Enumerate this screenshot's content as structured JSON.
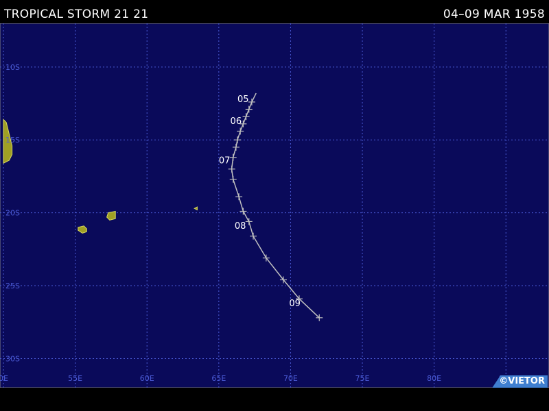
{
  "header": {
    "storm_name": "TROPICAL STORM 21 21",
    "date_range": "04–09 MAR 1958"
  },
  "map": {
    "projection": "lat-lon",
    "lon_range": [
      50,
      88
    ],
    "lat_range": [
      -7,
      -32
    ],
    "grid": true,
    "colors": {
      "ocean": "#0a0a5a",
      "grid": "#4b5bd6",
      "land": "#a0a024",
      "track": "#c0c0c0",
      "label": "#ffffff"
    },
    "lat_labels": [
      {
        "lat": -10,
        "text": "10S"
      },
      {
        "lat": -15,
        "text": "15S"
      },
      {
        "lat": -20,
        "text": "20S"
      },
      {
        "lat": -25,
        "text": "25S"
      },
      {
        "lat": -30,
        "text": "30S"
      }
    ],
    "lon_labels": [
      {
        "lon": 50,
        "text": "0E"
      },
      {
        "lon": 55,
        "text": "55E"
      },
      {
        "lon": 60,
        "text": "60E"
      },
      {
        "lon": 65,
        "text": "65E"
      },
      {
        "lon": 70,
        "text": "70E"
      },
      {
        "lon": 75,
        "text": "75E"
      },
      {
        "lon": 80,
        "text": "80E"
      },
      {
        "lon": 85,
        "text": "85E"
      }
    ],
    "track": [
      {
        "lon": 67.6,
        "lat": -11.8,
        "tick": false
      },
      {
        "lon": 67.3,
        "lat": -12.4,
        "tick": true
      },
      {
        "lon": 67.1,
        "lat": -12.9,
        "tick": true
      },
      {
        "lon": 66.9,
        "lat": -13.4,
        "tick": true
      },
      {
        "lon": 66.7,
        "lat": -13.9,
        "tick": true
      },
      {
        "lon": 66.5,
        "lat": -14.4,
        "tick": true
      },
      {
        "lon": 66.3,
        "lat": -15.0,
        "tick": true
      },
      {
        "lon": 66.2,
        "lat": -15.5,
        "tick": true
      },
      {
        "lon": 66.0,
        "lat": -16.2,
        "tick": true
      },
      {
        "lon": 65.9,
        "lat": -17.0,
        "tick": true
      },
      {
        "lon": 66.0,
        "lat": -17.7,
        "tick": true
      },
      {
        "lon": 66.4,
        "lat": -18.9,
        "tick": true
      },
      {
        "lon": 66.7,
        "lat": -19.9,
        "tick": true
      },
      {
        "lon": 67.1,
        "lat": -20.6,
        "tick": true
      },
      {
        "lon": 67.4,
        "lat": -21.6,
        "tick": true
      },
      {
        "lon": 68.3,
        "lat": -23.1,
        "tick": true
      },
      {
        "lon": 69.5,
        "lat": -24.6,
        "tick": true
      },
      {
        "lon": 70.6,
        "lat": -25.9,
        "tick": true
      },
      {
        "lon": 72.0,
        "lat": -27.2,
        "tick": true
      }
    ],
    "day_labels": [
      {
        "text": "05",
        "lon": 66.3,
        "lat": -12.4
      },
      {
        "text": "06",
        "lon": 65.8,
        "lat": -13.9
      },
      {
        "text": "07",
        "lon": 65.0,
        "lat": -16.6
      },
      {
        "text": "08",
        "lon": 66.1,
        "lat": -21.1
      },
      {
        "text": "09",
        "lon": 69.9,
        "lat": -26.4
      }
    ],
    "islands": [
      {
        "name": "madagascar-edge",
        "points": [
          [
            50.0,
            -13.6
          ],
          [
            50.2,
            -13.8
          ],
          [
            50.4,
            -14.6
          ],
          [
            50.6,
            -15.4
          ],
          [
            50.6,
            -16.0
          ],
          [
            50.4,
            -16.4
          ],
          [
            50.0,
            -16.6
          ]
        ]
      },
      {
        "name": "reunion",
        "points": [
          [
            55.2,
            -21.0
          ],
          [
            55.6,
            -20.9
          ],
          [
            55.8,
            -21.1
          ],
          [
            55.8,
            -21.3
          ],
          [
            55.5,
            -21.4
          ],
          [
            55.2,
            -21.2
          ]
        ]
      },
      {
        "name": "mauritius",
        "points": [
          [
            57.3,
            -20.0
          ],
          [
            57.8,
            -19.9
          ],
          [
            57.8,
            -20.4
          ],
          [
            57.4,
            -20.5
          ],
          [
            57.2,
            -20.3
          ]
        ]
      },
      {
        "name": "rodrigues",
        "points": [
          [
            63.3,
            -19.7
          ],
          [
            63.5,
            -19.6
          ],
          [
            63.5,
            -19.8
          ]
        ]
      }
    ]
  },
  "footer": {
    "credit": "©VIETOR"
  }
}
